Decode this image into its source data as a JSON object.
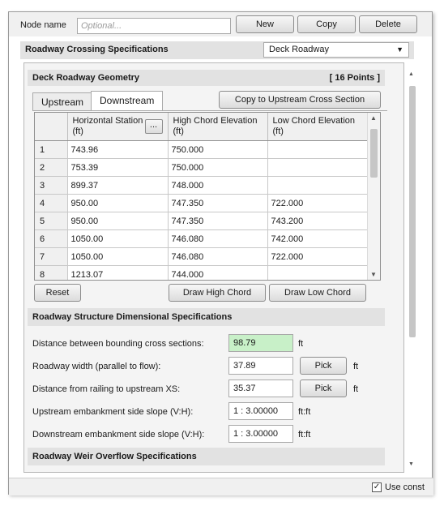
{
  "top": {
    "node_label": "Node name",
    "node_placeholder": "Optional...",
    "new_label": "New",
    "copy_label": "Copy",
    "delete_label": "Delete"
  },
  "roadway": {
    "title": "Roadway Crossing Specifications",
    "type_value": "Deck Roadway"
  },
  "geometry": {
    "title": "Deck Roadway Geometry",
    "points": "[ 16 Points ]",
    "tabs": [
      "Upstream",
      "Downstream"
    ],
    "active_tab": "Downstream",
    "copy_button": "Copy to Upstream Cross Section",
    "columns": [
      "Horizontal Station (ft)",
      "High Chord Elevation (ft)",
      "Low Chord Elevation (ft)"
    ],
    "ellipsis": "...",
    "rows": [
      {
        "n": "1",
        "station": "743.96",
        "high": "750.000",
        "low": ""
      },
      {
        "n": "2",
        "station": "753.39",
        "high": "750.000",
        "low": ""
      },
      {
        "n": "3",
        "station": "899.37",
        "high": "748.000",
        "low": ""
      },
      {
        "n": "4",
        "station": "950.00",
        "high": "747.350",
        "low": "722.000"
      },
      {
        "n": "5",
        "station": "950.00",
        "high": "747.350",
        "low": "743.200"
      },
      {
        "n": "6",
        "station": "1050.00",
        "high": "746.080",
        "low": "742.000"
      },
      {
        "n": "7",
        "station": "1050.00",
        "high": "746.080",
        "low": "722.000"
      },
      {
        "n": "8",
        "station": "1213.07",
        "high": "744.000",
        "low": ""
      }
    ],
    "reset_button": "Reset",
    "draw_high_button": "Draw High Chord",
    "draw_low_button": "Draw Low Chord"
  },
  "structure": {
    "title": "Roadway Structure Dimensional Specifications",
    "fields": [
      {
        "label": "Distance between bounding cross sections:",
        "value": "98.79",
        "unit": "ft",
        "pick": ""
      },
      {
        "label": "Roadway width (parallel to flow):",
        "value": "37.89",
        "unit": "ft",
        "pick": "Pick"
      },
      {
        "label": "Distance from railing to upstream XS:",
        "value": "35.37",
        "unit": "ft",
        "pick": "Pick"
      },
      {
        "label": "Upstream embankment side slope (V:H):",
        "value": "1 : 3.00000",
        "unit": "ft:ft",
        "pick": ""
      },
      {
        "label": "Downstream embankment side slope (V:H):",
        "value": "1 : 3.00000",
        "unit": "ft:ft",
        "pick": ""
      }
    ]
  },
  "weir": {
    "title": "Roadway Weir Overflow Specifications"
  },
  "bottom": {
    "checkbox_label": "Use const"
  },
  "colors": {
    "highlight_field": "#c8f0c8",
    "section_bg": "#e2e2e2"
  }
}
